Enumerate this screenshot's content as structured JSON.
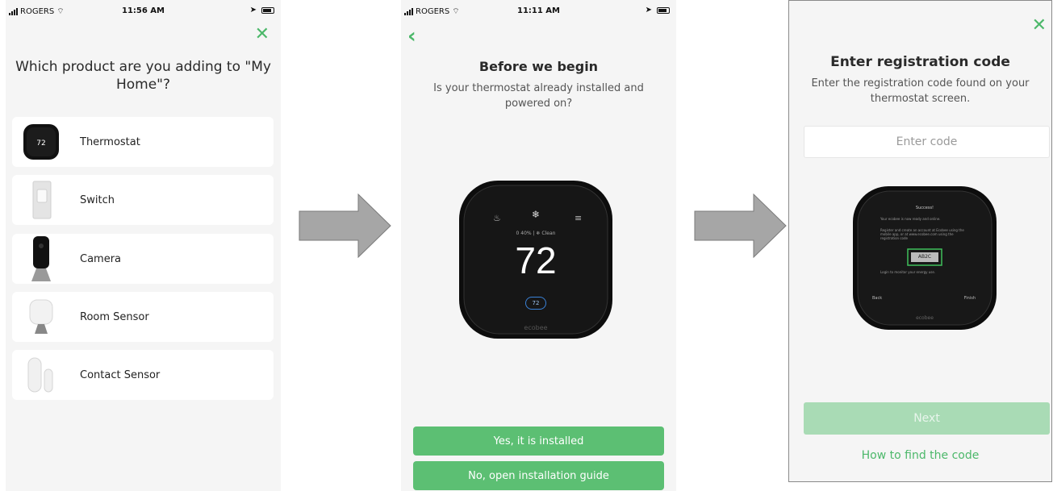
{
  "screen1": {
    "status": {
      "carrier": "ROGERS",
      "time": "11:56 AM"
    },
    "title": "Which product are you adding to \"My Home\"?",
    "products": [
      {
        "label": "Thermostat",
        "icon": "thermostat-icon"
      },
      {
        "label": "Switch",
        "icon": "switch-icon"
      },
      {
        "label": "Camera",
        "icon": "camera-icon"
      },
      {
        "label": "Room Sensor",
        "icon": "room-sensor-icon"
      },
      {
        "label": "Contact Sensor",
        "icon": "contact-sensor-icon"
      }
    ]
  },
  "screen2": {
    "status": {
      "carrier": "ROGERS",
      "time": "11:11 AM"
    },
    "title": "Before we begin",
    "subtitle": "Is your thermostat already installed and powered on?",
    "device": {
      "humidity": "0 40%",
      "air": "Clean",
      "temperature": "72",
      "setpoint": "72",
      "brand": "ecobee"
    },
    "yes_button": "Yes, it is installed",
    "no_button": "No, open installation guide"
  },
  "screen3": {
    "title": "Enter registration code",
    "subtitle": "Enter the registration code found on your thermostat screen.",
    "code_placeholder": "Enter code",
    "device": {
      "heading": "Success!",
      "line1": "Your ecobee is now ready and online.",
      "line2": "Register and create an account at Ecobee using the mobile app, or at www.ecobee.com using the registration code",
      "code": "AB2C",
      "footer": "Login to monitor your energy use.",
      "back": "Back",
      "finish": "Finish",
      "brand": "ecobee"
    },
    "next_button": "Next",
    "help_link": "How to find the code"
  },
  "colors": {
    "accent": "#4cb86a",
    "button": "#5cbf73",
    "next_disabled": "#a9dbb5",
    "arrow": "#a6a6a6"
  }
}
